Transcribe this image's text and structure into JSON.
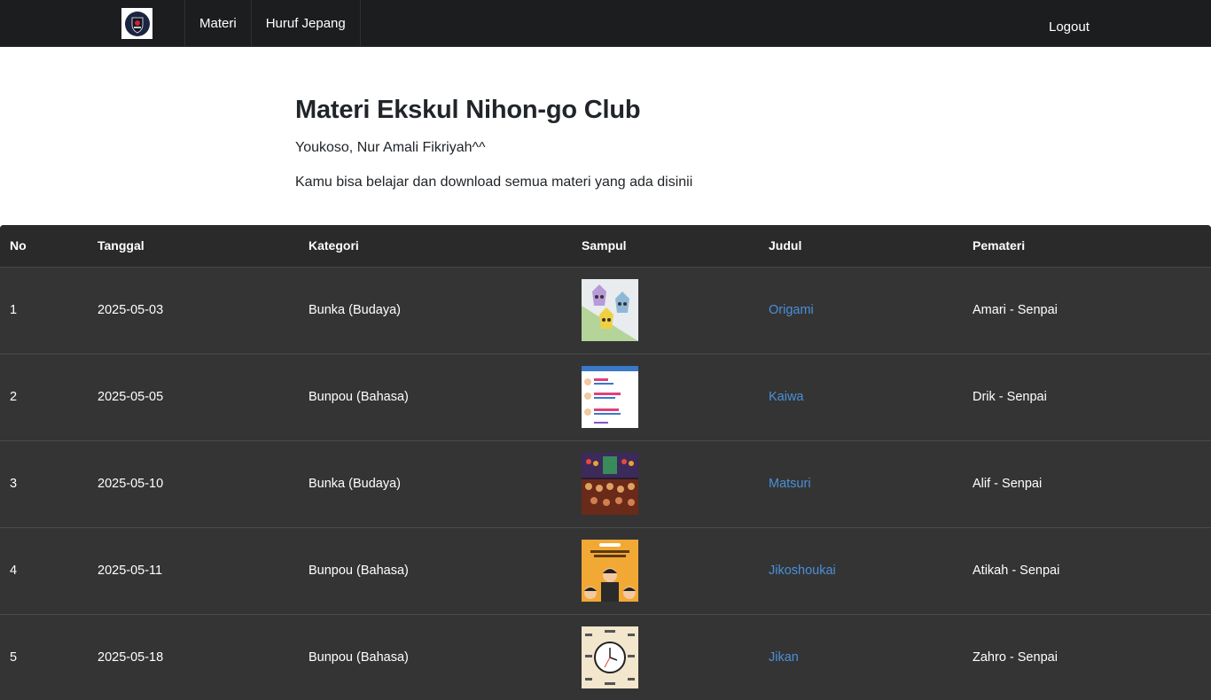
{
  "navbar": {
    "links": [
      "Materi",
      "Huruf Jepang"
    ],
    "logout": "Logout"
  },
  "header": {
    "title": "Materi Ekskul Nihon-go Club",
    "welcome": "Youkoso, Nur Amali Fikriyah^^",
    "description": "Kamu bisa belajar dan download semua materi yang ada disinii"
  },
  "table": {
    "headers": [
      "No",
      "Tanggal",
      "Kategori",
      "Sampul",
      "Judul",
      "Pemateri"
    ],
    "rows": [
      {
        "no": "1",
        "tanggal": "2025-05-03",
        "kategori": "Bunka (Budaya)",
        "sampul": "origami-thumbnail",
        "judul": "Origami",
        "pemateri": "Amari - Senpai"
      },
      {
        "no": "2",
        "tanggal": "2025-05-05",
        "kategori": "Bunpou (Bahasa)",
        "sampul": "kaiwa-thumbnail",
        "judul": "Kaiwa",
        "pemateri": "Drik - Senpai"
      },
      {
        "no": "3",
        "tanggal": "2025-05-10",
        "kategori": "Bunka (Budaya)",
        "sampul": "matsuri-thumbnail",
        "judul": "Matsuri",
        "pemateri": "Alif - Senpai"
      },
      {
        "no": "4",
        "tanggal": "2025-05-11",
        "kategori": "Bunpou (Bahasa)",
        "sampul": "jikoshoukai-thumbnail",
        "judul": "Jikoshoukai",
        "pemateri": "Atikah - Senpai"
      },
      {
        "no": "5",
        "tanggal": "2025-05-18",
        "kategori": "Bunpou (Bahasa)",
        "sampul": "jikan-thumbnail",
        "judul": "Jikan",
        "pemateri": "Zahro - Senpai"
      }
    ]
  },
  "colors": {
    "navbar_bg": "#1c1d1f",
    "table_bg": "#343435",
    "link": "#4a90d9"
  }
}
